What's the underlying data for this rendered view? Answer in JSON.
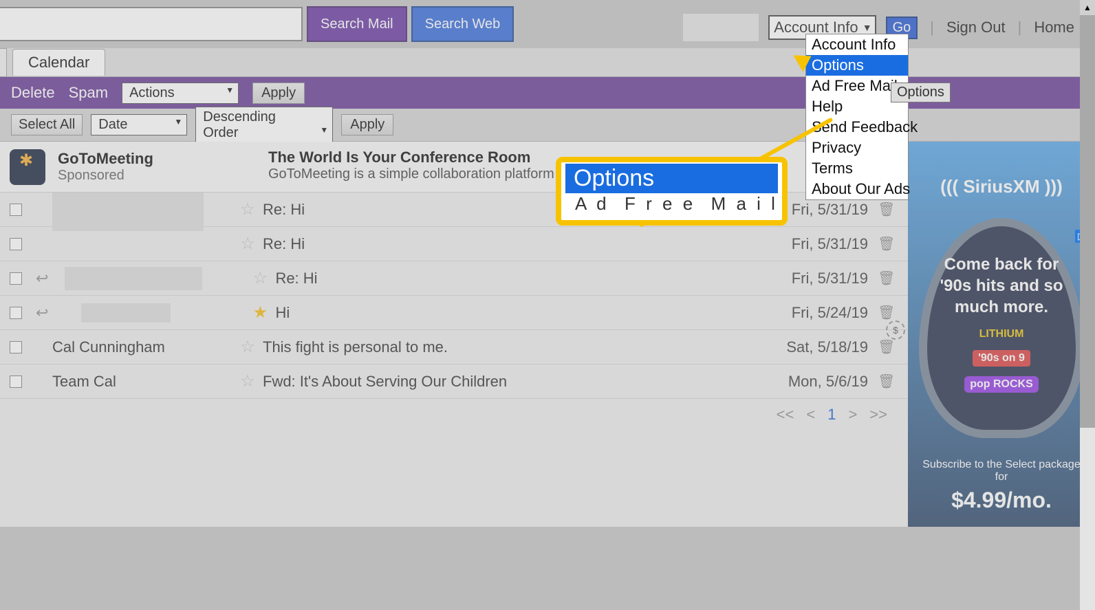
{
  "top": {
    "search_mail": "Search Mail",
    "search_web": "Search Web",
    "account_info_label": "Account Info",
    "go": "Go",
    "sign_out": "Sign Out",
    "home": "Home"
  },
  "dropdown": {
    "items": [
      "Account Info",
      "Options",
      "Ad Free Mail",
      "Help",
      "Send Feedback",
      "Privacy",
      "Terms",
      "About Our Ads"
    ],
    "highlight_index": 1,
    "tooltip": "Options"
  },
  "tabs": {
    "calendar": "Calendar"
  },
  "actionbar": {
    "delete": "Delete",
    "spam": "Spam",
    "actions": "Actions",
    "apply": "Apply"
  },
  "filterbar": {
    "select_all": "Select All",
    "date": "Date",
    "order": "Descending Order",
    "apply": "Apply"
  },
  "sponsored": {
    "name": "GoToMeeting",
    "tag": "Sponsored",
    "headline": "The World Is Your Conference Room",
    "sub": "GoToMeeting is a simple collaboration platform"
  },
  "rows": [
    {
      "sender": "",
      "subject": "Re: Hi",
      "date": "Fri, 5/31/19",
      "starred": false,
      "reply": false,
      "blur": "lg"
    },
    {
      "sender": "",
      "subject": "Re: Hi",
      "date": "Fri, 5/31/19",
      "starred": false,
      "reply": false,
      "blur": "none"
    },
    {
      "sender": "",
      "subject": "Re: Hi",
      "date": "Fri, 5/31/19",
      "starred": false,
      "reply": true,
      "blur": "md"
    },
    {
      "sender": "",
      "subject": "Hi",
      "date": "Fri, 5/24/19",
      "starred": true,
      "reply": true,
      "blur": "sm"
    },
    {
      "sender": "Cal Cunningham",
      "subject": "This fight is personal to me.",
      "date": "Sat, 5/18/19",
      "starred": false,
      "reply": false,
      "blur": "none"
    },
    {
      "sender": "Team Cal",
      "subject": "Fwd: It's About Serving Our Children",
      "date": "Mon, 5/6/19",
      "starred": false,
      "reply": false,
      "blur": "none"
    }
  ],
  "pager": {
    "first": "<<",
    "prev": "<",
    "page": "1",
    "next": ">",
    "last": ">>"
  },
  "ad": {
    "brand": "SiriusXM",
    "main": "Come back for '90s hits and so much more.",
    "chip1": "LITHIUM",
    "chip2": "'90s on 9",
    "chip3": "pop ROCKS",
    "sub": "Subscribe to the Select package for",
    "price": "$4.99/mo."
  },
  "callout": {
    "title": "Options",
    "under": "—— — ——"
  }
}
